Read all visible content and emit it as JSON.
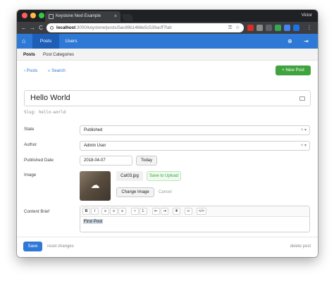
{
  "browser": {
    "tab_title": "Keystone Next Example",
    "tab_close": "×",
    "profile": "Victor",
    "url_host": "localhost",
    "url_path": ":3000/keystone/posts/5ac89b1468e5c539acff7fab",
    "back": "←",
    "forward": "→",
    "reload": "C",
    "key_glyph": "⚿",
    "star_glyph": "☆",
    "menu_glyph": "⋮",
    "colors": {
      "chrome_dark": "#202124",
      "chrome_tab": "#3c3d41"
    }
  },
  "appnav": {
    "home_glyph": "⌂",
    "tabs": [
      {
        "label": "Posts"
      },
      {
        "label": "Users"
      }
    ],
    "globe_glyph": "⊕",
    "signout_glyph": "⇥",
    "colors": {
      "bar": "#2f79d6",
      "active": "#1d5eb6"
    }
  },
  "subnav": {
    "items": [
      {
        "label": "Posts"
      },
      {
        "label": "Post Categories"
      }
    ]
  },
  "toolbar": {
    "back_label": "‹ Posts",
    "search_label": "⌕ Search",
    "new_post_label": "+ New Post",
    "colors": {
      "new_post": "#3fa33e"
    }
  },
  "item": {
    "name": "Hello World",
    "slug": "Slug: hello-world"
  },
  "fields": {
    "state": {
      "label": "State",
      "value": "Published"
    },
    "author": {
      "label": "Author",
      "value": "Admin User"
    },
    "published_date": {
      "label": "Published Date",
      "value": "2018-04-07",
      "today_label": "Today"
    },
    "image": {
      "label": "Image",
      "filename": "Cat03.jpg",
      "save_label": "Save to Upload",
      "change_label": "Change Image",
      "cancel_label": "Cancel",
      "upload_glyph": "☁"
    },
    "content_brief": {
      "label": "Content Brief",
      "toolbar": [
        "B",
        "I",
        "≡",
        "≡",
        "≡",
        "•",
        "1.",
        "⇤",
        "⇥",
        "T",
        "∞",
        "</>"
      ],
      "text": "First Post"
    },
    "select_clear": "×",
    "select_caret": "▾"
  },
  "footer": {
    "save_label": "Save",
    "reset_label": "reset changes",
    "delete_label": "delete post"
  }
}
